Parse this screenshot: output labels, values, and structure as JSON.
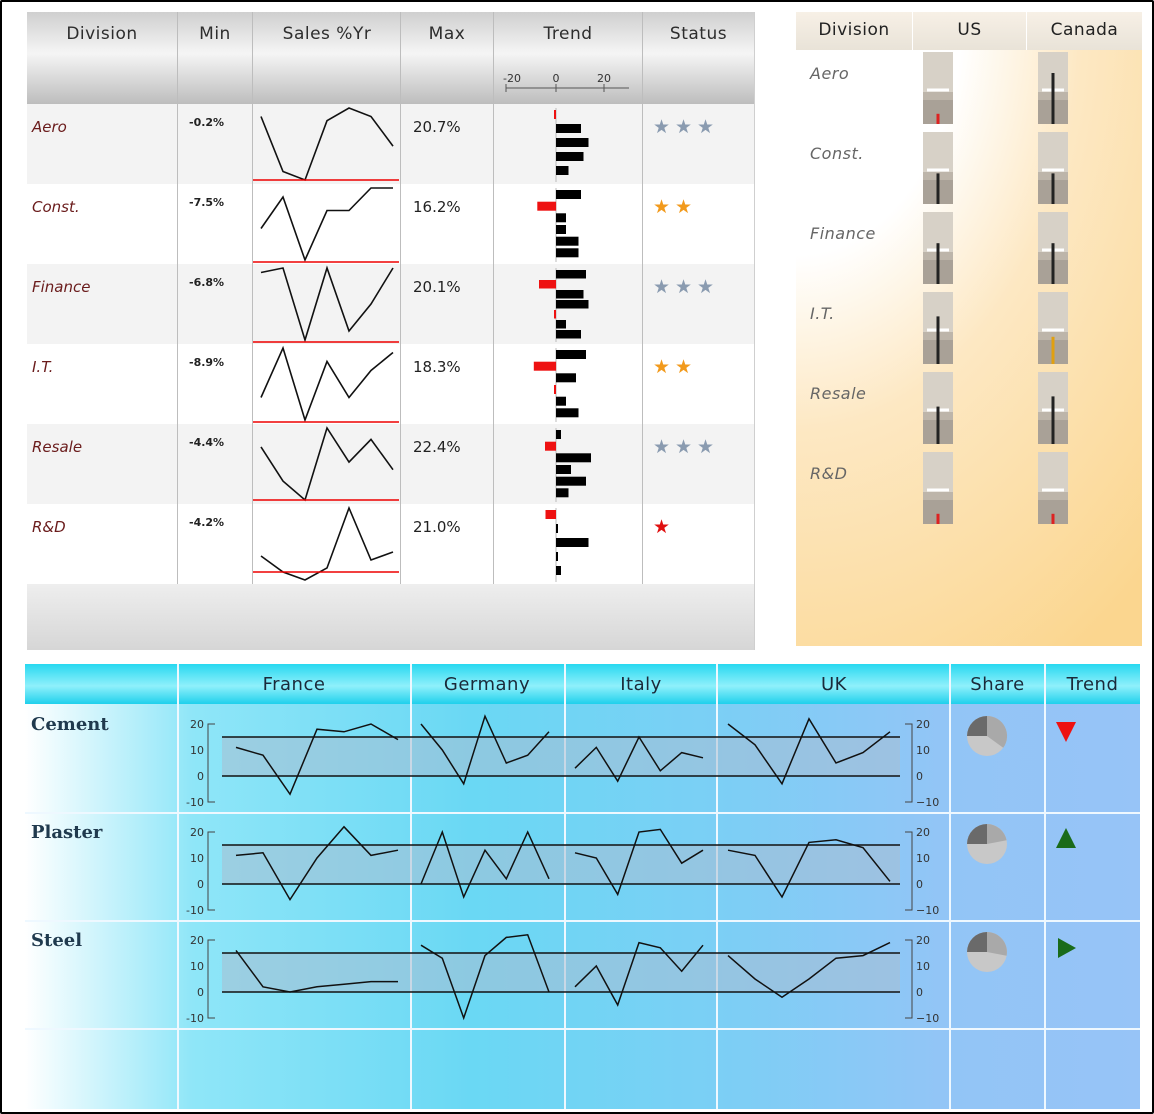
{
  "top_table": {
    "headers": {
      "division": "Division",
      "min": "Min",
      "sales": "Sales %Yr",
      "max": "Max",
      "trend": "Trend",
      "status": "Status"
    },
    "trend_axis_ticks": [
      "-20",
      "0",
      "20"
    ],
    "rows": [
      {
        "division": "Aero",
        "min": "-0.2%",
        "max": "20.7%",
        "sales": [
          15,
          2,
          0,
          14,
          17,
          15,
          8
        ],
        "bars": [
          -0.2,
          10,
          13,
          11,
          5
        ],
        "stars": 3,
        "star_color": "#8a9bb0"
      },
      {
        "division": "Const.",
        "min": "-7.5%",
        "max": "16.2%",
        "sales": [
          8,
          15,
          1,
          12,
          12,
          17,
          17
        ],
        "bars": [
          10,
          -7.5,
          4,
          4,
          9,
          9
        ],
        "stars": 2,
        "star_color": "#f29a1c"
      },
      {
        "division": "Finance",
        "min": "-6.8%",
        "max": "20.1%",
        "sales": [
          17,
          18,
          2,
          18,
          4,
          10,
          18
        ],
        "bars": [
          12,
          -6.8,
          11,
          13,
          -0.5,
          4,
          10
        ],
        "stars": 3,
        "star_color": "#8a9bb0"
      },
      {
        "division": "I.T.",
        "min": "-8.9%",
        "max": "18.3%",
        "sales": [
          6,
          17,
          1,
          14,
          6,
          12,
          16
        ],
        "bars": [
          12,
          -8.9,
          8,
          -0.5,
          4,
          9
        ],
        "stars": 2,
        "star_color": "#f29a1c"
      },
      {
        "division": "Resale",
        "min": "-4.4%",
        "max": "22.4%",
        "sales": [
          14,
          5,
          0,
          19,
          10,
          16,
          8
        ],
        "bars": [
          2,
          -4.4,
          14,
          6,
          12,
          5
        ],
        "stars": 3,
        "star_color": "#8a9bb0"
      },
      {
        "division": "R&D",
        "min": "-4.2%",
        "max": "21.0%",
        "sales": [
          4,
          0,
          -2,
          1,
          16,
          3,
          5
        ],
        "bars": [
          -4.2,
          0.5,
          13,
          0.5,
          2
        ],
        "stars": 1,
        "star_color": "#e01010"
      }
    ]
  },
  "gauge_panel": {
    "headers": {
      "division": "Division",
      "us": "US",
      "canada": "Canada"
    },
    "rows": [
      {
        "division": "Aero",
        "us": 0.15,
        "us_color": "#d22",
        "canada": 0.75,
        "canada_color": "#222"
      },
      {
        "division": "Const.",
        "us": 0.45,
        "us_color": "#222",
        "canada": 0.45,
        "canada_color": "#222"
      },
      {
        "division": "Finance",
        "us": 0.6,
        "us_color": "#222",
        "canada": 0.6,
        "canada_color": "#222"
      },
      {
        "division": "I.T.",
        "us": 0.7,
        "us_color": "#222",
        "canada": 0.4,
        "canada_color": "#e0a010"
      },
      {
        "division": "Resale",
        "us": 0.55,
        "us_color": "#222",
        "canada": 0.7,
        "canada_color": "#222"
      },
      {
        "division": "R&D",
        "us": 0.15,
        "us_color": "#d22",
        "canada": 0.15,
        "canada_color": "#d22"
      }
    ]
  },
  "bottom_panel": {
    "headers": {
      "france": "France",
      "germany": "Germany",
      "italy": "Italy",
      "uk": "UK",
      "share": "Share",
      "trend": "Trend"
    },
    "axis_ticks_left": [
      "20",
      "10",
      "0",
      "-10"
    ],
    "axis_ticks_right": [
      "20",
      "10",
      "0",
      "−10"
    ],
    "rows": [
      {
        "product": "Cement",
        "france": [
          11,
          8,
          -7,
          18,
          17,
          20,
          14
        ],
        "germany": [
          20,
          10,
          -3,
          23,
          5,
          8,
          17
        ],
        "italy": [
          3,
          11,
          -2,
          15,
          2,
          9,
          7
        ],
        "uk": [
          20,
          12,
          -3,
          22,
          5,
          9,
          17
        ],
        "share": 0.35,
        "trend": "down",
        "trend_color": "#ee1111"
      },
      {
        "product": "Plaster",
        "france": [
          11,
          12,
          -6,
          10,
          22,
          11,
          13
        ],
        "germany": [
          0,
          20,
          -5,
          13,
          2,
          20,
          2
        ],
        "italy": [
          12,
          10,
          -4,
          20,
          21,
          8,
          13
        ],
        "uk": [
          13,
          11,
          -5,
          16,
          17,
          14,
          1
        ],
        "share": 0.22,
        "trend": "up",
        "trend_color": "#1a6b1a"
      },
      {
        "product": "Steel",
        "france": [
          16,
          2,
          0,
          2,
          3,
          4,
          4
        ],
        "germany": [
          18,
          13,
          -10,
          14,
          21,
          22,
          0
        ],
        "italy": [
          2,
          10,
          -5,
          19,
          17,
          8,
          18
        ],
        "uk": [
          14,
          5,
          -2,
          5,
          13,
          14,
          19
        ],
        "share": 0.28,
        "trend": "right",
        "trend_color": "#1a6b1a"
      }
    ]
  }
}
